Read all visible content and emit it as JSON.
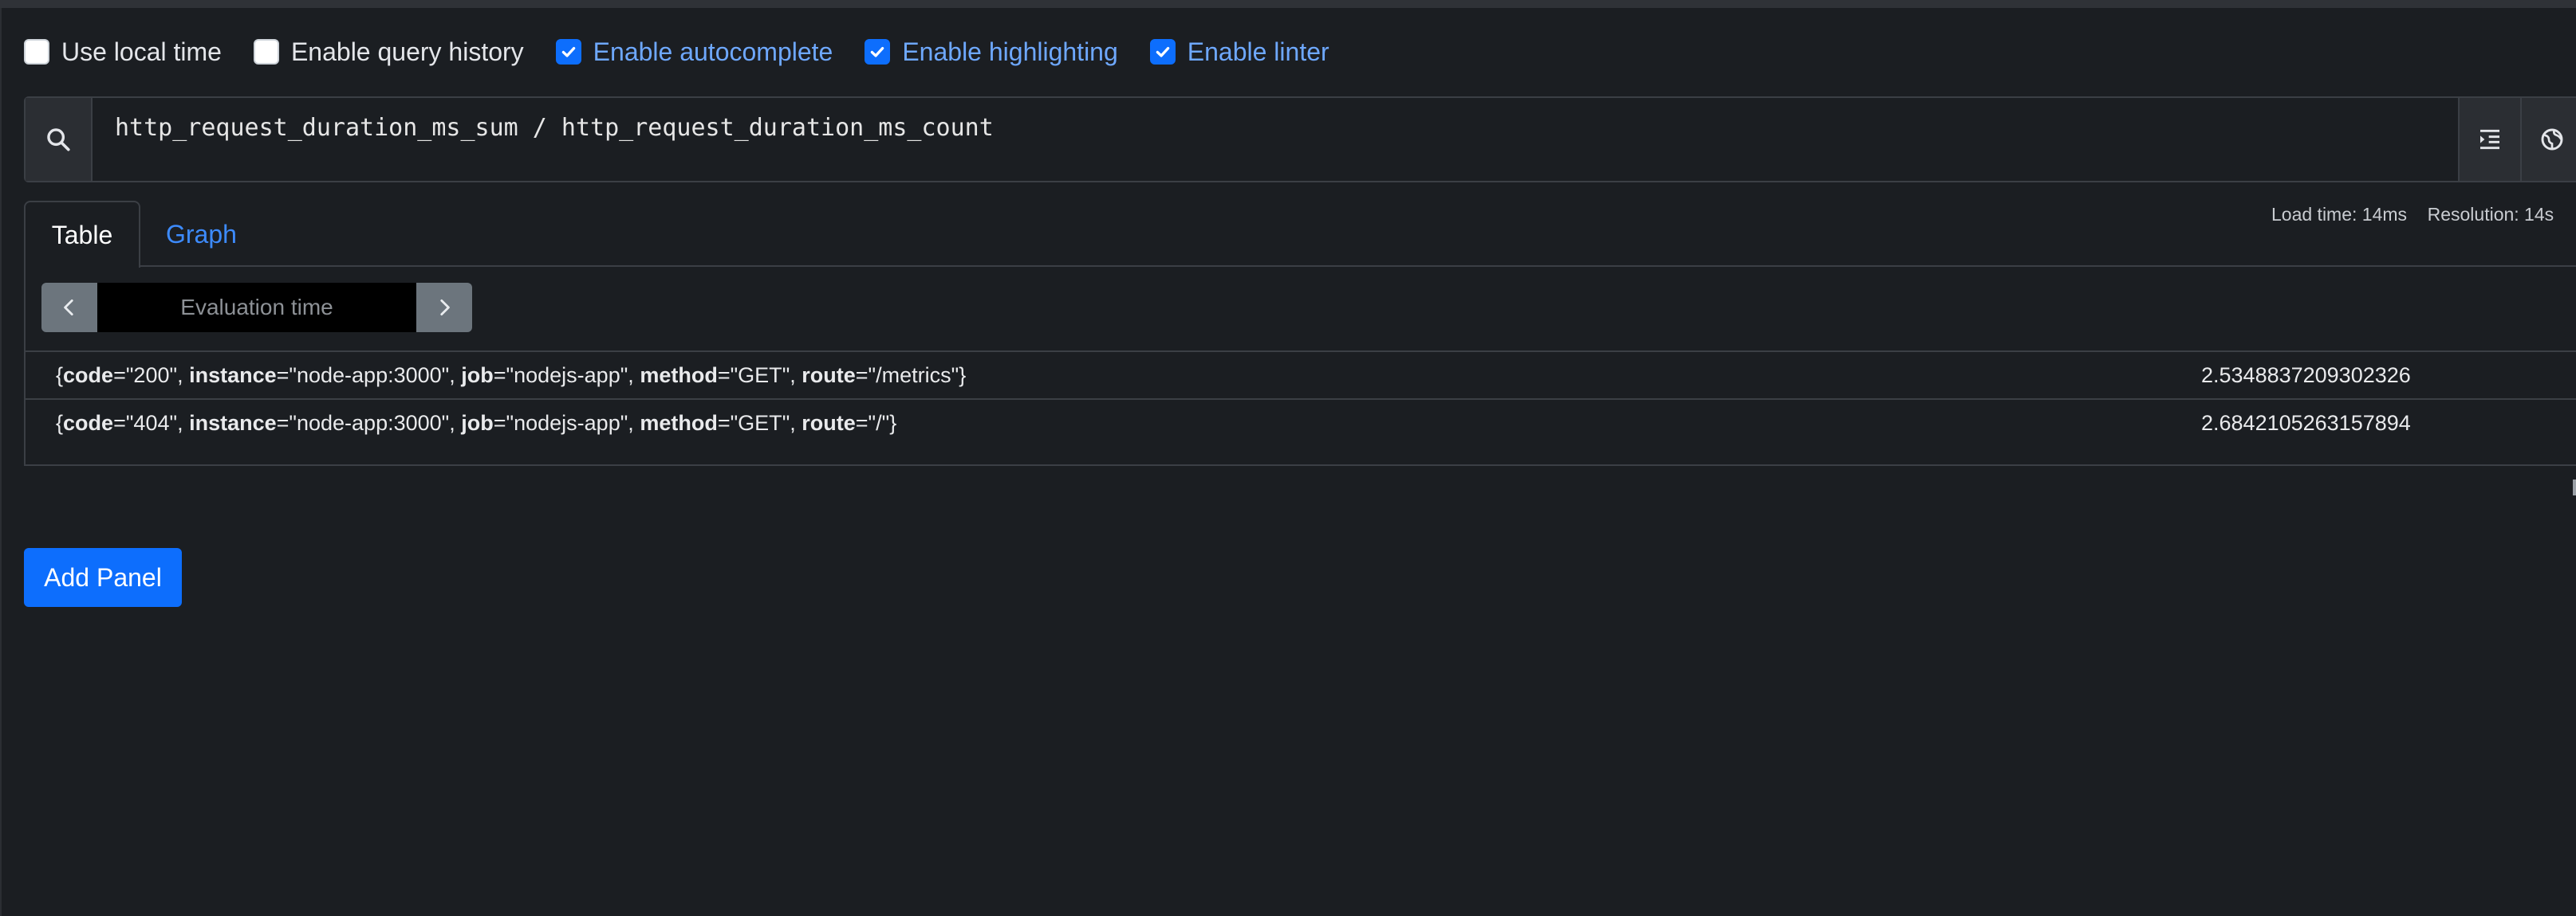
{
  "options": [
    {
      "label": "Use local time",
      "checked": false
    },
    {
      "label": "Enable query history",
      "checked": false
    },
    {
      "label": "Enable autocomplete",
      "checked": true
    },
    {
      "label": "Enable highlighting",
      "checked": true
    },
    {
      "label": "Enable linter",
      "checked": true
    }
  ],
  "query": {
    "expression": "http_request_duration_ms_sum / http_request_duration_ms_count"
  },
  "tabs": {
    "table": "Table",
    "graph": "Graph",
    "active": "Table"
  },
  "meta": {
    "load_time": "Load time: 14ms",
    "resolution": "Resolution: 14s"
  },
  "eval": {
    "placeholder": "Evaluation time"
  },
  "results": [
    {
      "code": "200",
      "instance": "node-app:3000",
      "job": "nodejs-app",
      "method": "GET",
      "route": "/metrics",
      "value": "2.5348837209302326"
    },
    {
      "code": "404",
      "instance": "node-app:3000",
      "job": "nodejs-app",
      "method": "GET",
      "route": "/",
      "value": "2.6842105263157894"
    }
  ],
  "add_panel_label": "Add Panel",
  "colors": {
    "background": "#1b1e22",
    "accent": "#0d6efd",
    "link": "#3d8bfd",
    "border": "#3b3f45"
  }
}
